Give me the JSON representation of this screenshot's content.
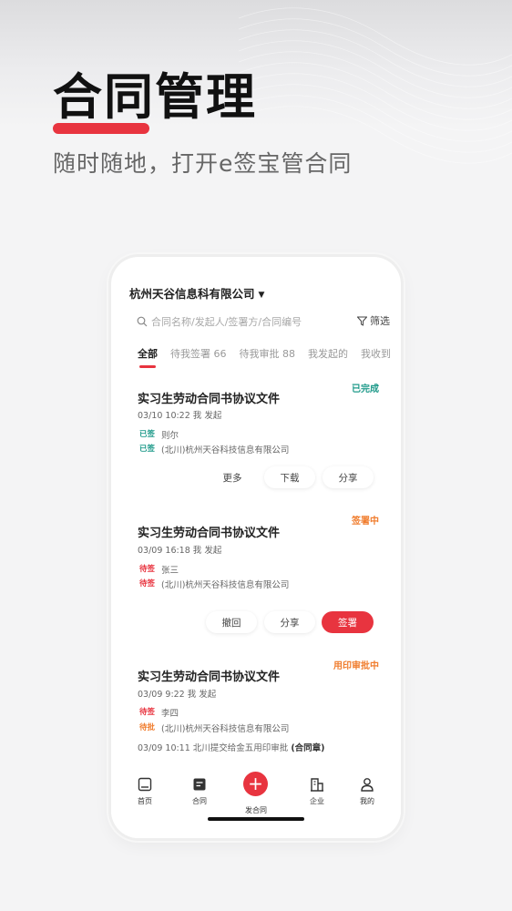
{
  "hero": {
    "title": "合同管理",
    "subtitle": "随时随地，打开e签宝管合同"
  },
  "header": {
    "company": "杭州天谷信息科有限公司"
  },
  "search": {
    "placeholder": "合同名称/发起人/签署方/合同编号",
    "filter_label": "筛选"
  },
  "tabs": [
    {
      "label": "全部",
      "active": true
    },
    {
      "label": "待我签署 66",
      "active": false
    },
    {
      "label": "待我审批 88",
      "active": false
    },
    {
      "label": "我发起的",
      "active": false
    },
    {
      "label": "我收到",
      "active": false
    }
  ],
  "contracts": [
    {
      "title": "实习生劳动合同书协议文件",
      "status": "已完成",
      "status_color": "#1f9a8a",
      "meta": "03/10 10:22  我 发起",
      "parties": [
        {
          "tag": "已签",
          "name": "则尔"
        },
        {
          "tag": "已签",
          "name": "(北川)杭州天谷科技信息有限公司"
        }
      ],
      "actions": [
        "更多",
        "下载",
        "分享"
      ]
    },
    {
      "title": "实习生劳动合同书协议文件",
      "status": "签署中",
      "status_color": "#f07d2e",
      "meta": "03/09 16:18  我 发起",
      "parties": [
        {
          "tag": "待签",
          "name": "张三"
        },
        {
          "tag": "待签",
          "name": "(北川)杭州天谷科技信息有限公司"
        }
      ],
      "actions": [
        "撤回",
        "分享",
        "签署"
      ]
    },
    {
      "title": "实习生劳动合同书协议文件",
      "status": "用印审批中",
      "status_color": "#f07d2e",
      "meta": "03/09 9:22  我 发起",
      "parties": [
        {
          "tag": "待签",
          "name": "李四"
        },
        {
          "tag": "待批",
          "name": "(北川)杭州天谷科技信息有限公司"
        }
      ],
      "log_text": "03/09 10:11 北川提交给金五用印审批 ",
      "log_bold": "(合同章)"
    }
  ],
  "bottom_nav": [
    {
      "label": "首页",
      "icon": "home-icon"
    },
    {
      "label": "合同",
      "icon": "contract-icon"
    },
    {
      "label": "发合同",
      "icon": "plus-icon"
    },
    {
      "label": "企业",
      "icon": "building-icon"
    },
    {
      "label": "我的",
      "icon": "user-icon"
    }
  ],
  "colors": {
    "accent": "#e8343f",
    "done": "#1f9a8a",
    "pending": "#f07d2e"
  }
}
